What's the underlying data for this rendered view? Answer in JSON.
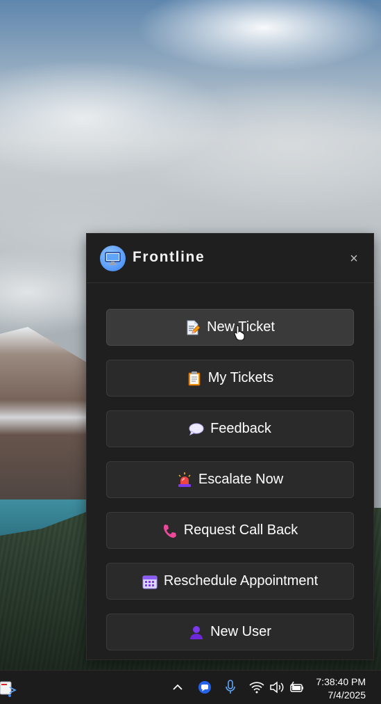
{
  "app": {
    "title": "Frontline",
    "logo_icon": "monitor-icon",
    "close_label": "×"
  },
  "menu": [
    {
      "label": "New Ticket",
      "icon": "memo-icon",
      "state": "hover"
    },
    {
      "label": "My Tickets",
      "icon": "clipboard-icon",
      "state": "normal"
    },
    {
      "label": "Feedback",
      "icon": "speech-bubble-icon",
      "state": "normal"
    },
    {
      "label": "Escalate Now",
      "icon": "siren-icon",
      "state": "normal"
    },
    {
      "label": "Request Call Back",
      "icon": "phone-icon",
      "state": "normal"
    },
    {
      "label": "Reschedule Appointment",
      "icon": "calendar-icon",
      "state": "normal"
    },
    {
      "label": "New User",
      "icon": "user-icon",
      "state": "normal"
    }
  ],
  "taskbar": {
    "time": "7:38:40 PM",
    "date": "7/4/2025"
  },
  "colors": {
    "panel_bg": "#1f1f1f",
    "button_bg": "#2a2a2a",
    "button_hover_bg": "#3a3a3a",
    "taskbar_bg": "#1c1c1c",
    "accent_blue": "#3b82f6"
  }
}
